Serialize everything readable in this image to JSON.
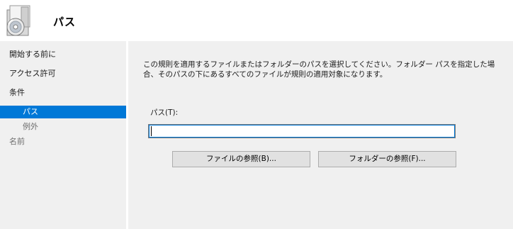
{
  "header": {
    "title": "パス"
  },
  "nav": {
    "items": [
      {
        "label": "開始する前に"
      },
      {
        "label": "アクセス許可"
      },
      {
        "label": "条件"
      },
      {
        "label": "パス"
      },
      {
        "label": "例外"
      },
      {
        "label": "名前"
      }
    ]
  },
  "main": {
    "description": "この規則を適用するファイルまたはフォルダーのパスを選択してください。フォルダー パスを指定した場合、そのパスの下にあるすべてのファイルが規則の適用対象になります。",
    "path_label": "パス(T):",
    "path_value": "",
    "browse_file_label": "ファイルの参照(B)...",
    "browse_folder_label": "フォルダーの参照(F)..."
  },
  "colors": {
    "selection": "#0078d7",
    "panel_background": "#f0f0f0",
    "button_face": "#e1e1e1"
  },
  "icons": {
    "header": "software-installer-icon"
  }
}
